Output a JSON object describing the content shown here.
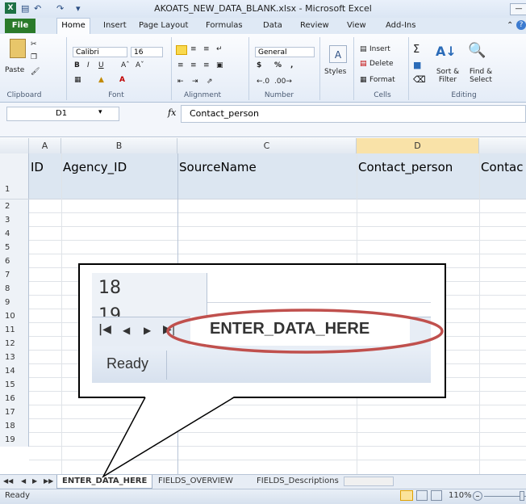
{
  "window": {
    "title": "AKOATS_NEW_DATA_BLANK.xlsx - Microsoft Excel"
  },
  "ribbon": {
    "tabs": [
      "File",
      "Home",
      "Insert",
      "Page Layout",
      "Formulas",
      "Data",
      "Review",
      "View",
      "Add-Ins"
    ],
    "clipboard": {
      "paste": "Paste",
      "label": "Clipboard"
    },
    "font": {
      "name": "Calibri",
      "size": "16",
      "label": "Font"
    },
    "alignment": {
      "label": "Alignment"
    },
    "number": {
      "format": "General",
      "currency": "$",
      "percent": "%",
      "comma": ",",
      "label": "Number"
    },
    "styles": {
      "label": "Styles"
    },
    "cells": {
      "insert": "Insert",
      "delete": "Delete",
      "format": "Format",
      "label": "Cells"
    },
    "editing": {
      "sort_filter": "Sort & Filter",
      "find_select": "Find & Select",
      "label": "Editing"
    }
  },
  "formula_bar": {
    "name_box": "D1",
    "fx": "fx",
    "value": "Contact_person"
  },
  "grid": {
    "columns": [
      "A",
      "B",
      "C",
      "D"
    ],
    "header_row": [
      "ID",
      "Agency_ID",
      "SourceName",
      "Contact_person",
      "Contac"
    ],
    "row_numbers": [
      "1",
      "2",
      "3",
      "4",
      "5",
      "6",
      "7",
      "8",
      "9",
      "10",
      "11",
      "12",
      "13",
      "14",
      "15",
      "16",
      "17",
      "18",
      "19"
    ]
  },
  "sheet_tabs": [
    "ENTER_DATA_HERE",
    "FIELDS_OVERVIEW",
    "FIELDS_Descriptions"
  ],
  "status": {
    "ready": "Ready",
    "zoom": "110%"
  },
  "callout": {
    "row_18": "18",
    "row_19": "19",
    "tab": "ENTER_DATA_HERE",
    "ready": "Ready"
  },
  "colors": {
    "file_tab": "#2a7a2a",
    "header_fill": "#dce6f1",
    "highlight_ellipse": "#c0504d"
  }
}
